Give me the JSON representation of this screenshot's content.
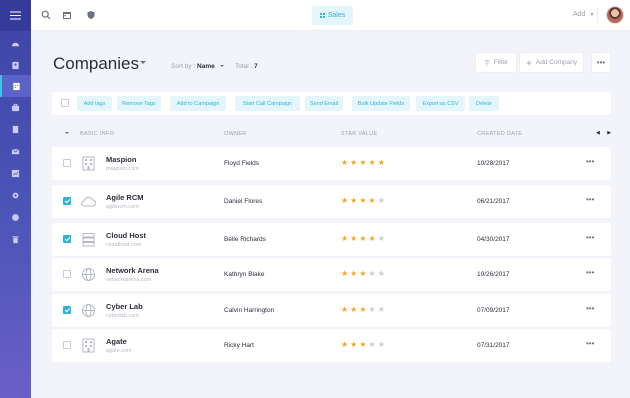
{
  "topbar": {
    "sales_label": "Sales",
    "add_label": "Add"
  },
  "sidebar": {
    "items": [
      {
        "icon": "dashboard-icon"
      },
      {
        "icon": "contacts-icon"
      },
      {
        "icon": "companies-icon",
        "active": true
      },
      {
        "icon": "deals-icon"
      },
      {
        "icon": "documents-icon"
      },
      {
        "icon": "mail-icon"
      },
      {
        "icon": "reports-icon"
      },
      {
        "icon": "settings-icon"
      },
      {
        "icon": "help-icon"
      },
      {
        "icon": "trash-icon"
      }
    ]
  },
  "header": {
    "title": "Companies",
    "sort_prefix": "Sort by :",
    "sort_value": "Name",
    "total_prefix": "Total :",
    "total_value": "7",
    "filter_label": "Filter",
    "add_company_label": "Add Company",
    "more_label": "•••"
  },
  "bulk_actions": [
    "Add tags",
    "Remove Tags",
    "Add to Campaign",
    "Start Call Campaign",
    "Send Email",
    "Bulk Update Fields",
    "Export as CSV",
    "Delete"
  ],
  "table": {
    "headers": {
      "basic_info": "BASIC INFO",
      "owner": "OWNER",
      "star_value": "STAR VALUE",
      "created_date": "CREATED DATE"
    },
    "rows": [
      {
        "name": "Maspion",
        "site": "maspion.com",
        "owner": "Floyd Fields",
        "stars": 5,
        "created": "10/28/2017",
        "checked": false,
        "icon": "building-icon"
      },
      {
        "name": "Agile RCM",
        "site": "agilercm.com",
        "owner": "Daniel Flores",
        "stars": 4,
        "created": "06/21/2017",
        "checked": true,
        "icon": "cloud-icon"
      },
      {
        "name": "Cloud Host",
        "site": "cloudhost.com",
        "owner": "Belle Richards",
        "stars": 4,
        "created": "04/30/2017",
        "checked": true,
        "icon": "server-icon"
      },
      {
        "name": "Network Arena",
        "site": "networkarena.com",
        "owner": "Kathryn Blake",
        "stars": 3,
        "created": "10/26/2017",
        "checked": false,
        "icon": "globe-icon"
      },
      {
        "name": "Cyber Lab",
        "site": "cyberlab.com",
        "owner": "Calvin Harrington",
        "stars": 3,
        "created": "07/09/2017",
        "checked": true,
        "icon": "globe-icon"
      },
      {
        "name": "Agate",
        "site": "agate.com",
        "owner": "Ricky Hart",
        "stars": 3,
        "created": "07/31/2017",
        "checked": false,
        "icon": "building-icon"
      }
    ],
    "row_more_label": "•••"
  },
  "colors": {
    "accent": "#2fb3d9",
    "sidebar": "#4c55b8",
    "star": "#f5a623"
  }
}
